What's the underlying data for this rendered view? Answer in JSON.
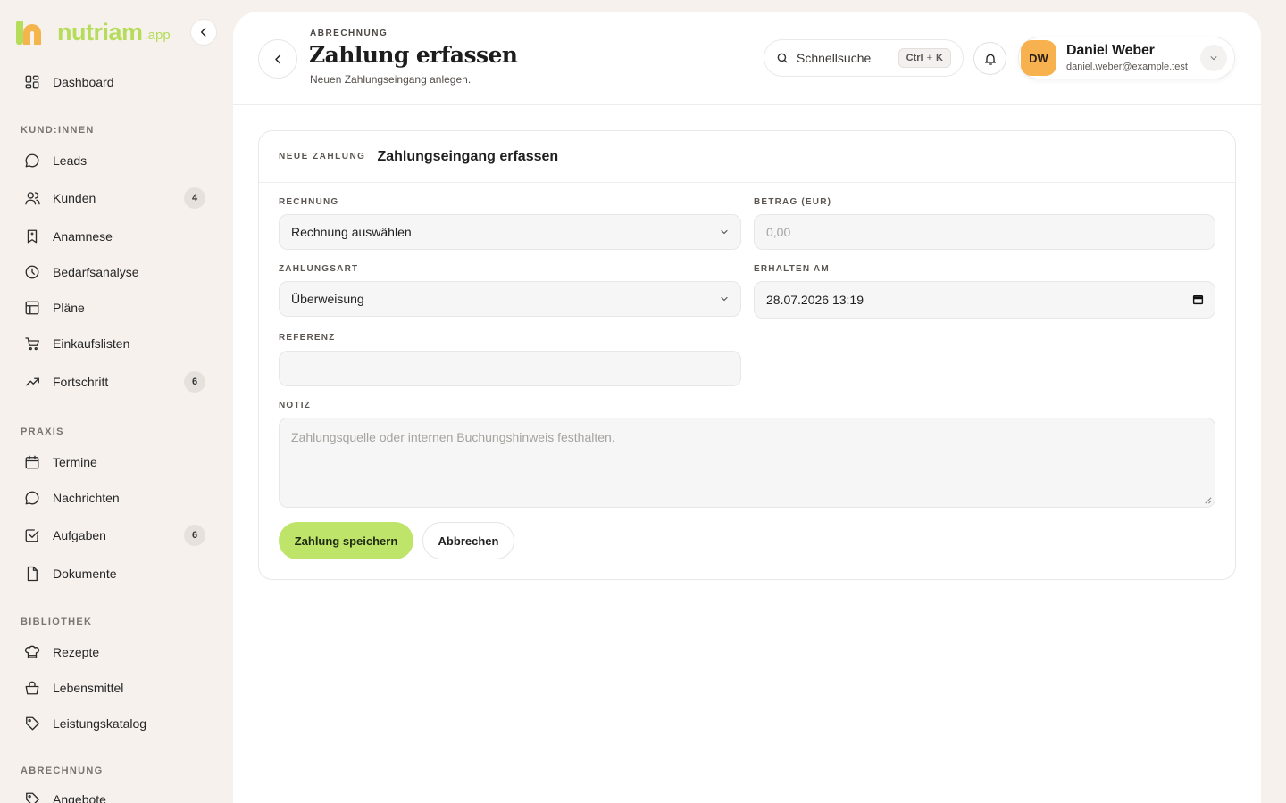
{
  "brand": {
    "name": "nutriam",
    "tld": ".app"
  },
  "colors": {
    "accent": "#bfe46a",
    "brand_green": "#b5dc5a",
    "brand_orange": "#f5b54d",
    "avatar": "#f8b14f"
  },
  "sidebar": {
    "dashboard": {
      "label": "Dashboard",
      "icon": "dashboard-icon"
    },
    "sections": [
      {
        "title": "KUND:INNEN",
        "items": [
          {
            "label": "Leads",
            "icon": "chat-bubble-icon",
            "badge": ""
          },
          {
            "label": "Kunden",
            "icon": "users-icon",
            "badge": "4"
          },
          {
            "label": "Anamnese",
            "icon": "bookmark-file-icon",
            "badge": ""
          },
          {
            "label": "Bedarfsanalyse",
            "icon": "clock-icon",
            "badge": ""
          },
          {
            "label": "Pläne",
            "icon": "table-icon",
            "badge": ""
          },
          {
            "label": "Einkaufslisten",
            "icon": "cart-icon",
            "badge": ""
          },
          {
            "label": "Fortschritt",
            "icon": "trend-up-icon",
            "badge": "6"
          }
        ]
      },
      {
        "title": "PRAXIS",
        "items": [
          {
            "label": "Termine",
            "icon": "calendar-icon",
            "badge": ""
          },
          {
            "label": "Nachrichten",
            "icon": "message-icon",
            "badge": ""
          },
          {
            "label": "Aufgaben",
            "icon": "checkbox-icon",
            "badge": "6"
          },
          {
            "label": "Dokumente",
            "icon": "document-icon",
            "badge": ""
          }
        ]
      },
      {
        "title": "BIBLIOTHEK",
        "items": [
          {
            "label": "Rezepte",
            "icon": "chef-hat-icon",
            "badge": ""
          },
          {
            "label": "Lebensmittel",
            "icon": "basket-icon",
            "badge": ""
          },
          {
            "label": "Leistungskatalog",
            "icon": "tag-icon",
            "badge": ""
          }
        ]
      },
      {
        "title": "ABRECHNUNG",
        "items": [
          {
            "label": "Angebote",
            "icon": "offer-icon",
            "badge": ""
          }
        ]
      }
    ]
  },
  "header": {
    "eyebrow": "ABRECHNUNG",
    "title": "Zahlung erfassen",
    "subtitle": "Neuen Zahlungseingang anlegen.",
    "search_placeholder": "Schnellsuche",
    "shortcut": {
      "key1": "Ctrl",
      "plus": "+",
      "key2": "K"
    }
  },
  "user": {
    "initials": "DW",
    "name": "Daniel Weber",
    "email": "daniel.weber@example.test"
  },
  "form": {
    "eyebrow": "NEUE ZAHLUNG",
    "title": "Zahlungseingang erfassen",
    "invoice": {
      "label": "RECHNUNG",
      "value": "Rechnung auswählen"
    },
    "amount": {
      "label": "BETRAG (EUR)",
      "placeholder": "0,00"
    },
    "method": {
      "label": "ZAHLUNGSART",
      "value": "Überweisung"
    },
    "received": {
      "label": "ERHALTEN AM",
      "value": "28.07.2026 13:19"
    },
    "reference": {
      "label": "REFERENZ",
      "value": ""
    },
    "note": {
      "label": "NOTIZ",
      "placeholder": "Zahlungsquelle oder internen Buchungshinweis festhalten."
    },
    "save_label": "Zahlung speichern",
    "cancel_label": "Abbrechen"
  }
}
